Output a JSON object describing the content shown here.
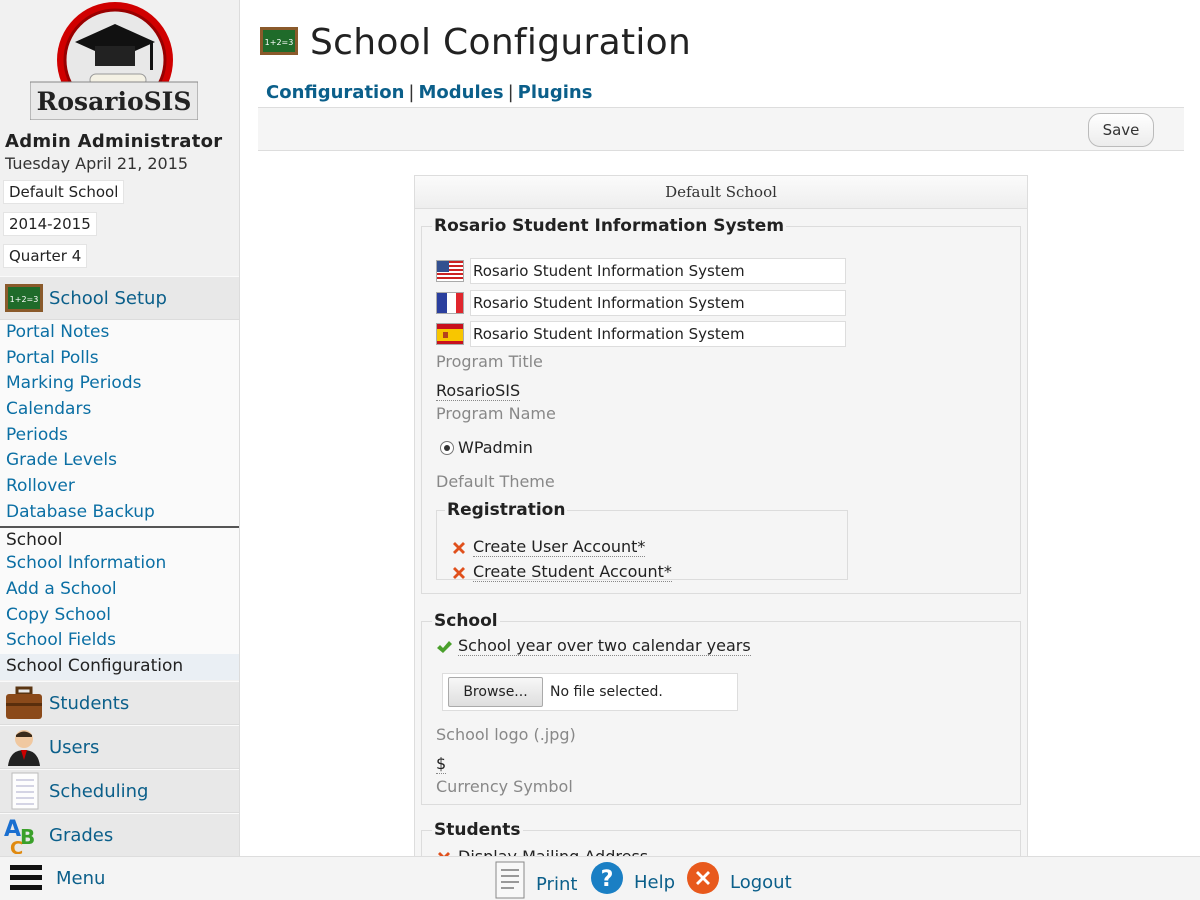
{
  "sidebar": {
    "logo_text": "RosarioSIS",
    "user_name": "Admin Administrator",
    "date": "Tuesday April 21, 2015",
    "school_select": "Default School",
    "year_select": "2014-2015",
    "period_select": "Quarter 4",
    "active_module": "School Setup",
    "submenu": [
      {
        "label": "Portal Notes"
      },
      {
        "label": "Portal Polls"
      },
      {
        "label": "Marking Periods"
      },
      {
        "label": "Calendars"
      },
      {
        "label": "Periods"
      },
      {
        "label": "Grade Levels"
      },
      {
        "label": "Rollover"
      },
      {
        "label": "Database Backup"
      }
    ],
    "school_heading": "School",
    "school_items": [
      {
        "label": "School Information"
      },
      {
        "label": "Add a School"
      },
      {
        "label": "Copy School"
      },
      {
        "label": "School Fields"
      },
      {
        "label": "School Configuration"
      }
    ],
    "modules": [
      {
        "label": "Students",
        "icon": "briefcase-icon"
      },
      {
        "label": "Users",
        "icon": "user-icon"
      },
      {
        "label": "Scheduling",
        "icon": "notepad-icon"
      },
      {
        "label": "Grades",
        "icon": "abc-icon"
      }
    ]
  },
  "footer": {
    "menu_label": "Menu",
    "print_label": "Print",
    "help_label": "Help",
    "logout_label": "Logout"
  },
  "header": {
    "title": "School Configuration",
    "tabs": [
      "Configuration",
      "Modules",
      "Plugins"
    ],
    "save_label": "Save"
  },
  "form": {
    "header": "Default School",
    "section_rosario": {
      "legend": "Rosario Student Information System",
      "titles": [
        {
          "lang": "en",
          "value": "Rosario Student Information System"
        },
        {
          "lang": "fr",
          "value": "Rosario Student Information System"
        },
        {
          "lang": "es",
          "value": "Rosario Student Information System"
        }
      ],
      "program_title_label": "Program Title",
      "program_name_value": "RosarioSIS",
      "program_name_label": "Program Name",
      "theme_option": "WPadmin",
      "theme_label": "Default Theme",
      "registration_legend": "Registration",
      "registration_items": [
        "Create User Account*",
        "Create Student Account*"
      ]
    },
    "section_school": {
      "legend": "School",
      "year_option": "School year over two calendar years",
      "browse_label": "Browse...",
      "file_status": "No file selected.",
      "logo_label": "School logo (.jpg)",
      "currency_value": "$",
      "currency_label": "Currency Symbol"
    },
    "section_students": {
      "legend": "Students",
      "first_item": "Display Mailing Address"
    }
  },
  "colors": {
    "link": "#0b5f8a",
    "sidebar_bg": "#f1f1f1",
    "module_bg": "#e8e8e8",
    "check": "#4aa02c",
    "cross": "#e0501c"
  }
}
